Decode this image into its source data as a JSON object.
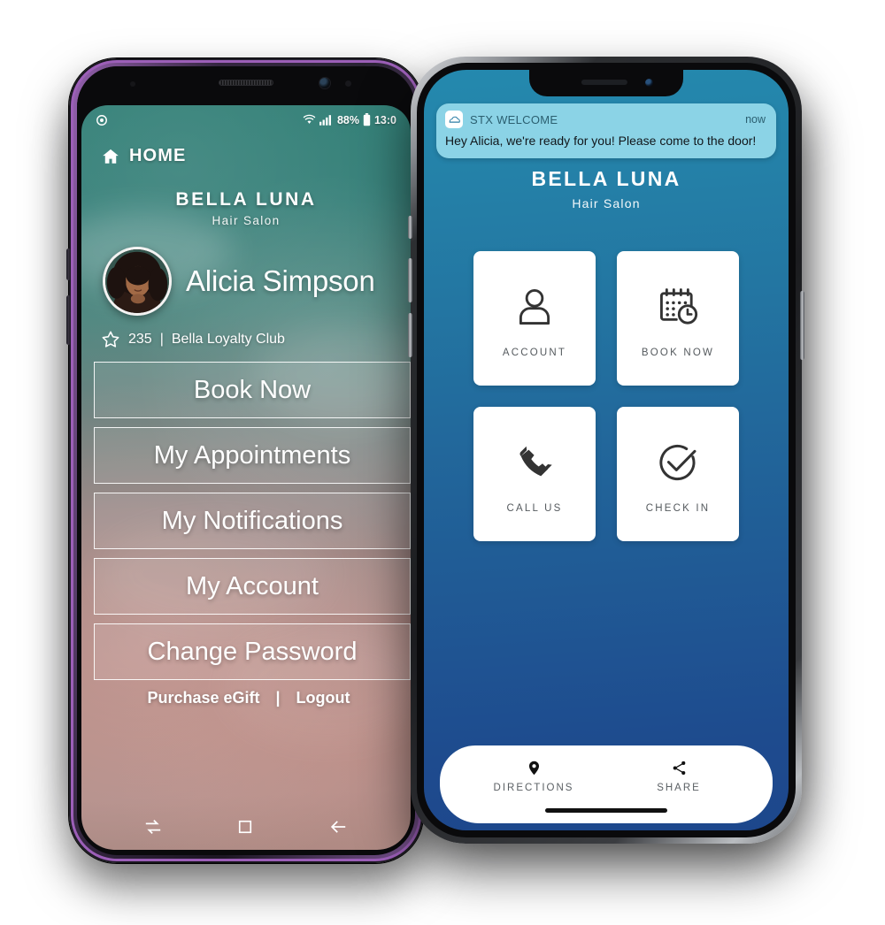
{
  "samsung": {
    "status_bar": {
      "left_icon": "circular-clock-icon",
      "wifi_icon": "wifi-icon",
      "signal_icon": "cellular-signal-icon",
      "battery_percent": "88%",
      "battery_icon": "battery-icon",
      "time": "13:0"
    },
    "header": {
      "icon": "home-icon",
      "label": "HOME"
    },
    "brand": {
      "name": "BELLA LUNA",
      "subtitle": "Hair Salon"
    },
    "profile": {
      "avatar": "user-avatar",
      "name": "Alicia Simpson",
      "loyalty_icon": "star-icon",
      "loyalty_points": "235",
      "loyalty_separator": "|",
      "loyalty_program": "Bella Loyalty Club"
    },
    "menu_buttons": [
      {
        "label": "Book Now"
      },
      {
        "label": "My Appointments"
      },
      {
        "label": "My Notifications"
      },
      {
        "label": "My Account"
      },
      {
        "label": "Change Password"
      }
    ],
    "footer_links": {
      "egift": "Purchase eGift",
      "separator": "|",
      "logout": "Logout"
    },
    "nav_bar": [
      {
        "name": "recents-button",
        "icon": "recents-icon"
      },
      {
        "name": "home-button",
        "icon": "square-home-icon"
      },
      {
        "name": "back-button",
        "icon": "back-arrow-icon"
      }
    ]
  },
  "iphone": {
    "notification": {
      "app_icon": "stx-cloud-app-icon",
      "app_name": "STX  WELCOME",
      "time": "now",
      "message": "Hey Alicia, we're ready for you! Please come to the door!"
    },
    "brand": {
      "name": "BELLA LUNA",
      "subtitle": "Hair Salon"
    },
    "tiles": [
      {
        "label": "ACCOUNT",
        "icon": "person-icon"
      },
      {
        "label": "BOOK NOW",
        "icon": "calendar-clock-icon"
      },
      {
        "label": "CALL US",
        "icon": "phone-icon"
      },
      {
        "label": "CHECK IN",
        "icon": "check-circle-icon"
      }
    ],
    "bottom_bar": [
      {
        "label": "DIRECTIONS",
        "icon": "map-pin-icon"
      },
      {
        "label": "SHARE",
        "icon": "share-icon"
      }
    ]
  },
  "colors": {
    "iphone_gradient_top": "#2489ae",
    "iphone_gradient_bottom": "#1d478c",
    "notification_bg": "#8bd3e6",
    "samsung_top": "#2e7d74",
    "samsung_bottom": "#b08a85",
    "tile_label": "#555a5e",
    "samsung_bezel": "#9c5fb8"
  }
}
